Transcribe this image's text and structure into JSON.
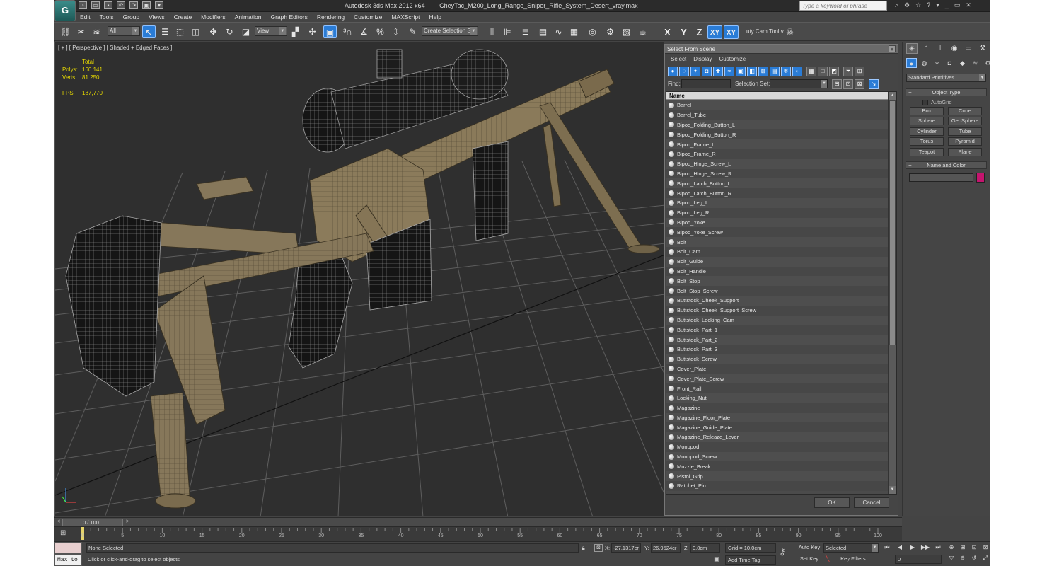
{
  "app": {
    "logo": "G",
    "title_parts": [
      "Autodesk 3ds Max  2012 x64",
      "CheyTac_M200_Long_Range_Sniper_Rifle_System_Desert_vray.max"
    ],
    "search_placeholder": "Type a keyword or phrase"
  },
  "menu": [
    "Edit",
    "Tools",
    "Group",
    "Views",
    "Create",
    "Modifiers",
    "Animation",
    "Graph Editors",
    "Rendering",
    "Customize",
    "MAXScript",
    "Help"
  ],
  "toolbar": {
    "selection_filter": "All",
    "reference_coord": "View",
    "named_selection": "Create Selection Se",
    "axis_x": "X",
    "axis_y": "Y",
    "axis_z": "Z",
    "axis_xy": "XY",
    "axis_xy2": "XY",
    "camera_tool": "uty Cam Tool v"
  },
  "viewport": {
    "label": "[ + ] [ Perspective ] [ Shaded + Edged Faces ]",
    "stats": {
      "total_label": "Total",
      "polys_label": "Polys:",
      "polys_value": "160 141",
      "verts_label": "Verts:",
      "verts_value": "81 250",
      "fps_label": "FPS:",
      "fps_value": "187,770"
    }
  },
  "dialog": {
    "title": "Select From Scene",
    "close": "x",
    "menu": [
      "Select",
      "Display",
      "Customize"
    ],
    "find_label": "Find:",
    "selection_set_label": "Selection Set:",
    "column_header": "Name",
    "items": [
      "Barrel",
      "Barrel_Tube",
      "Bipod_Folding_Button_L",
      "Bipod_Folding_Button_R",
      "Bipod_Frame_L",
      "Bipod_Frame_R",
      "Bipod_Hinge_Screw_L",
      "Bipod_Hinge_Screw_R",
      "Bipod_Latch_Button_L",
      "Bipod_Latch_Button_R",
      "Bipod_Leg_L",
      "Bipod_Leg_R",
      "Bipod_Yoke",
      "Bipod_Yoke_Screw",
      "Bolt",
      "Bolt_Cam",
      "Bolt_Guide",
      "Bolt_Handle",
      "Bolt_Stop",
      "Bolt_Stop_Screw",
      "Buttstock_Cheek_Support",
      "Buttstock_Cheek_Support_Screw",
      "Buttstock_Locking_Cam",
      "Buttstock_Part_1",
      "Buttstock_Part_2",
      "Buttstock_Part_3",
      "Buttstock_Screw",
      "Cover_Plate",
      "Cover_Plate_Screw",
      "Front_Rail",
      "Locking_Nut",
      "Magazine",
      "Magazine_Floor_Plate",
      "Magazine_Guide_Plate",
      "Magazine_Releaze_Lever",
      "Monopod",
      "Monopod_Screw",
      "Muzzle_Break",
      "Pistol_Grip",
      "Ratchet_Pin"
    ],
    "ok": "OK",
    "cancel": "Cancel"
  },
  "command_panel": {
    "category": "Standard Primitives",
    "object_type": "Object Type",
    "autogrid": "AutoGrid",
    "primitives": [
      "Box",
      "Cone",
      "Sphere",
      "GeoSphere",
      "Cylinder",
      "Tube",
      "Torus",
      "Pyramid",
      "Teapot",
      "Plane"
    ],
    "name_and_color": "Name and Color",
    "color": "#c4146e"
  },
  "timeline": {
    "frame_display": "0 / 100",
    "prev": "<",
    "next": ">",
    "ticks": [
      "0",
      "5",
      "10",
      "15",
      "20",
      "25",
      "30",
      "35",
      "40",
      "45",
      "50",
      "55",
      "60",
      "65",
      "70",
      "75",
      "80",
      "85",
      "90",
      "95",
      "100"
    ]
  },
  "status": {
    "selection": "None Selected",
    "prompt": "Click or click-and-drag to select objects",
    "maxscript_label": "Max to",
    "x_label": "X:",
    "x_value": "-27,1317cr",
    "y_label": "Y:",
    "y_value": "26,9524cr",
    "z_label": "Z:",
    "z_value": "0,0cm",
    "grid": "Grid = 10,0cm",
    "add_time_tag": "Add Time Tag",
    "auto_key": "Auto Key",
    "set_key": "Set Key",
    "key_mode": "Selected",
    "key_filters": "Key Filters...",
    "frame": "0"
  }
}
